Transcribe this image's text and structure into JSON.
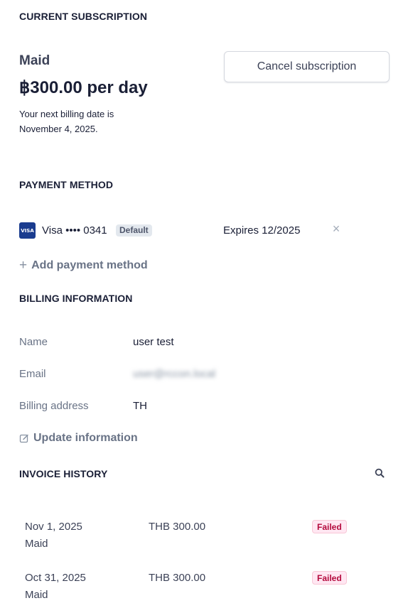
{
  "subscription": {
    "section_title": "CURRENT SUBSCRIPTION",
    "plan_name": "Maid",
    "price": "฿300.00 per day",
    "next_billing_line1": "Your next billing date is",
    "next_billing_line2": "November 4, 2025.",
    "cancel_label": "Cancel subscription"
  },
  "payment": {
    "section_title": "PAYMENT METHOD",
    "card_brand_logo": "VISA",
    "card_label": "Visa •••• 0341",
    "default_badge": "Default",
    "expires": "Expires 12/2025",
    "remove_icon": "close-icon",
    "add_label": "Add payment method"
  },
  "billing": {
    "section_title": "BILLING INFORMATION",
    "name_label": "Name",
    "name_value": "user test",
    "email_label": "Email",
    "email_value": "user@rccon.local",
    "address_label": "Billing address",
    "address_value": "TH",
    "update_label": "Update information"
  },
  "invoices": {
    "section_title": "INVOICE HISTORY",
    "rows": [
      {
        "date": "Nov 1, 2025",
        "desc": "Maid",
        "amount": "THB 300.00",
        "status": "Failed"
      },
      {
        "date": "Oct 31, 2025",
        "desc": "Maid",
        "amount": "THB 300.00",
        "status": "Failed"
      }
    ]
  },
  "colors": {
    "failed_bg": "#ffe7f2",
    "failed_text": "#b3093c",
    "visa_blue": "#1a3c8f"
  }
}
